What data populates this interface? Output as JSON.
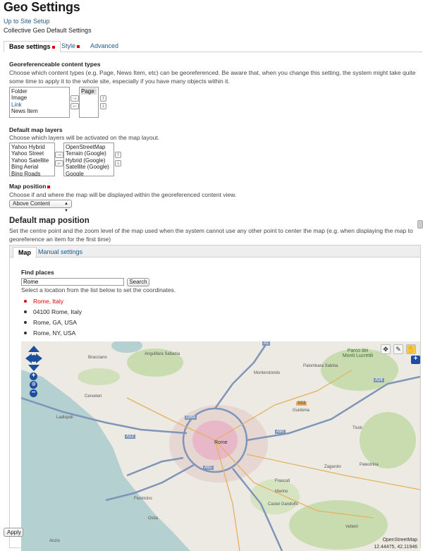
{
  "header": {
    "title": "Geo Settings",
    "up_link": "Up to Site Setup",
    "subtitle": "Collective Geo Default Settings"
  },
  "tabs": [
    {
      "label": "Base settings",
      "active": true,
      "required": true
    },
    {
      "label": "Style",
      "active": false,
      "required": true
    },
    {
      "label": "Advanced",
      "active": false,
      "required": false
    }
  ],
  "content_types": {
    "label": "Georeferenceable content types",
    "help": "Choose which content types (e.g. Page, News Item, etc) can be georeferenced. Be aware that, when you change this setting, the system might take quite some time to apply it to the whole site, especially if you have many objects within it.",
    "available": [
      "Folder",
      "Image",
      "Link",
      "News Item"
    ],
    "selected": [
      "Page"
    ]
  },
  "map_layers": {
    "label": "Default map layers",
    "help": "Choose which layers will be activated on the map layout.",
    "available": [
      "Yahoo Hybrid",
      "Yahoo Street",
      "Yahoo Satellite",
      "Bing Aerial",
      "Bing Roads"
    ],
    "selected": [
      "OpenStreetMap",
      "Terrain (Google)",
      "Hybrid (Google)",
      "Satellite (Google)",
      "Google"
    ]
  },
  "map_position": {
    "label": "Map position",
    "help": "Choose if and where the map will be displayed within the georeferenced content view.",
    "value": "Above Content"
  },
  "default_position": {
    "title": "Default map position",
    "help": "Set the centre point and the zoom level of the map used when the system cannot use any other point to center the map (e.g. when displaying the map to georeference an item for the first time)",
    "tabs": [
      {
        "label": "Map",
        "active": true
      },
      {
        "label": "Manual settings",
        "active": false
      }
    ]
  },
  "find_places": {
    "label": "Find places",
    "query": "Rome",
    "button": "Search",
    "help": "Select a location from the list below to set the coordinates.",
    "results": [
      "Rome, Italy",
      "04100 Rome, Italy",
      "Rome, GA, USA",
      "Rome, NY, USA"
    ]
  },
  "map": {
    "attribution": "OpenStreetMap",
    "coords": "12.44475, 42.11946",
    "place_labels": [
      "Rome",
      "Tivoli",
      "Fiumicino",
      "Ostia",
      "Monterotondo",
      "Palombara Sabina",
      "Guidonia",
      "Frascati",
      "Ladispoli",
      "Cerveteri",
      "Castel Gandolfo",
      "Velletri",
      "Anzio",
      "Zagarolo",
      "Palestrina",
      "Parco dei Monti Lucretili",
      "Bracciano",
      "Anguillara Sabazia",
      "Marino"
    ],
    "road_labels": [
      "A1",
      "A12",
      "A24",
      "A91",
      "GRA",
      "A90",
      "SS3"
    ],
    "colors": {
      "water": "#b5d0d0",
      "land": "#eceae3",
      "park": "#c8dcb0",
      "urban": "#e7d7d3",
      "motorway": "#7f95b8",
      "city_core": "#e8b8c8"
    }
  },
  "footer": {
    "apply_label": "Apply"
  }
}
